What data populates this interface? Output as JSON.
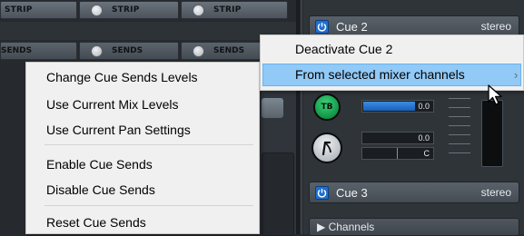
{
  "mixer": {
    "strip_label": "STRIP",
    "sends_label": "SENDS"
  },
  "cues": [
    {
      "name": "Cue 2",
      "type": "stereo"
    },
    {
      "name": "Cue 3",
      "type": "stereo"
    }
  ],
  "channel": {
    "tb_label": "TB",
    "level_value": "0.0",
    "pan_value": "0.0",
    "pan_position": "C",
    "level_fill_fraction": 0.75
  },
  "channels_section": {
    "label": "Channels"
  },
  "context_menu": {
    "items": [
      "Change Cue Sends Levels",
      "Use Current Mix Levels",
      "Use Current Pan Settings",
      "Enable Cue Sends",
      "Disable Cue Sends",
      "Reset Cue Sends"
    ]
  },
  "submenu": {
    "items": [
      "Deactivate Cue 2",
      "From selected mixer channels"
    ],
    "highlighted": "From selected mixer channels"
  },
  "colors": {
    "accent_blue": "#1f6fd1",
    "tb_green": "#149a4a",
    "highlight": "#91c9f7"
  },
  "icons": {
    "power": "power-icon",
    "lock": "lock-icon",
    "submenu_arrow": "chevron-right-icon",
    "cursor": "mouse-pointer-icon"
  }
}
